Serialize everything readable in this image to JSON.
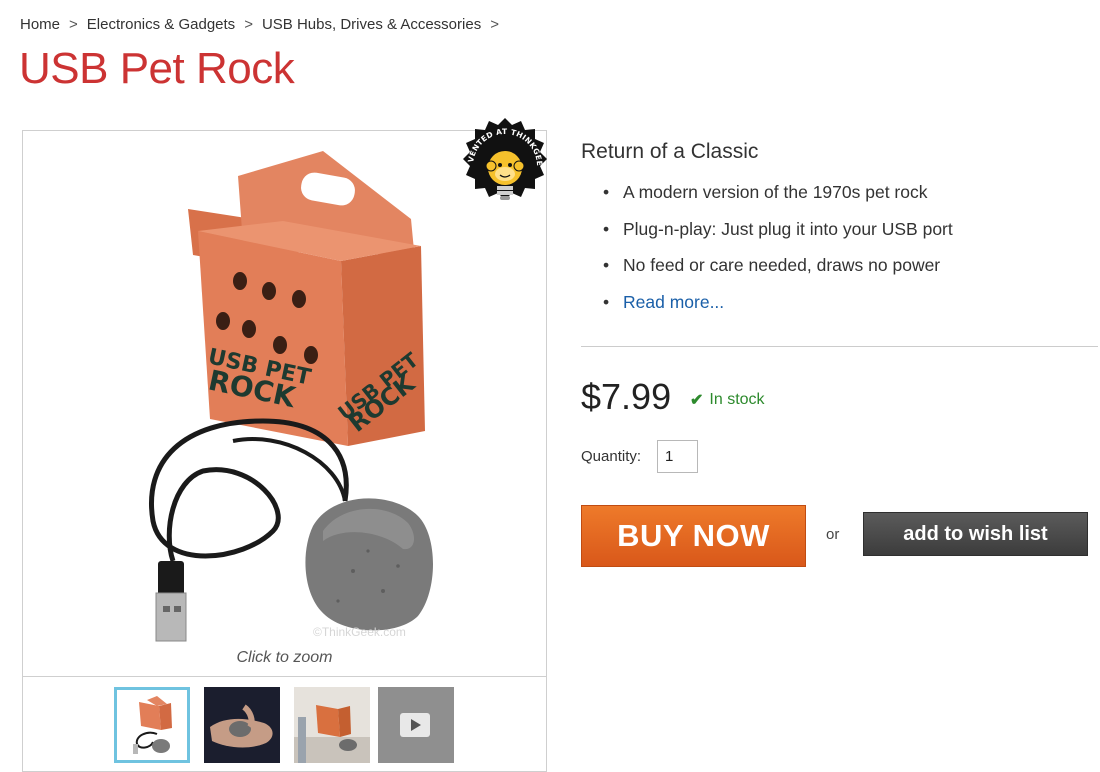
{
  "breadcrumb": {
    "items": [
      "Home",
      "Electronics & Gadgets",
      "USB Hubs, Drives & Accessories"
    ],
    "separator": ">"
  },
  "product": {
    "title": "USB Pet Rock",
    "subtitle": "Return of a Classic",
    "features": [
      "A modern version of the 1970s pet rock",
      "Plug-n-play: Just plug it into your USB port",
      "No feed or care needed, draws no power"
    ],
    "read_more": "Read more...",
    "price": "$7.99",
    "stock_status": "In stock",
    "quantity_label": "Quantity:",
    "quantity_value": "1",
    "buy_label": "BUY NOW",
    "or_label": "or",
    "wish_label": "add to wish list"
  },
  "gallery": {
    "zoom_label": "Click to zoom",
    "watermark": "©ThinkGeek.com",
    "box_text_line1": "USB PET",
    "box_text_line2": "ROCK",
    "badge_text": "INVENTED AT THINKGEEK",
    "thumbnails": [
      "box-thumbnail",
      "hand-thumbnail",
      "desk-thumbnail",
      "video-thumbnail"
    ]
  },
  "colors": {
    "title": "#cc3333",
    "buy_button": "#e06420",
    "wish_button": "#4a4a4a",
    "link": "#1a5fa8",
    "in_stock": "#2d8a2d",
    "thumb_active_border": "#6fc3e0"
  }
}
